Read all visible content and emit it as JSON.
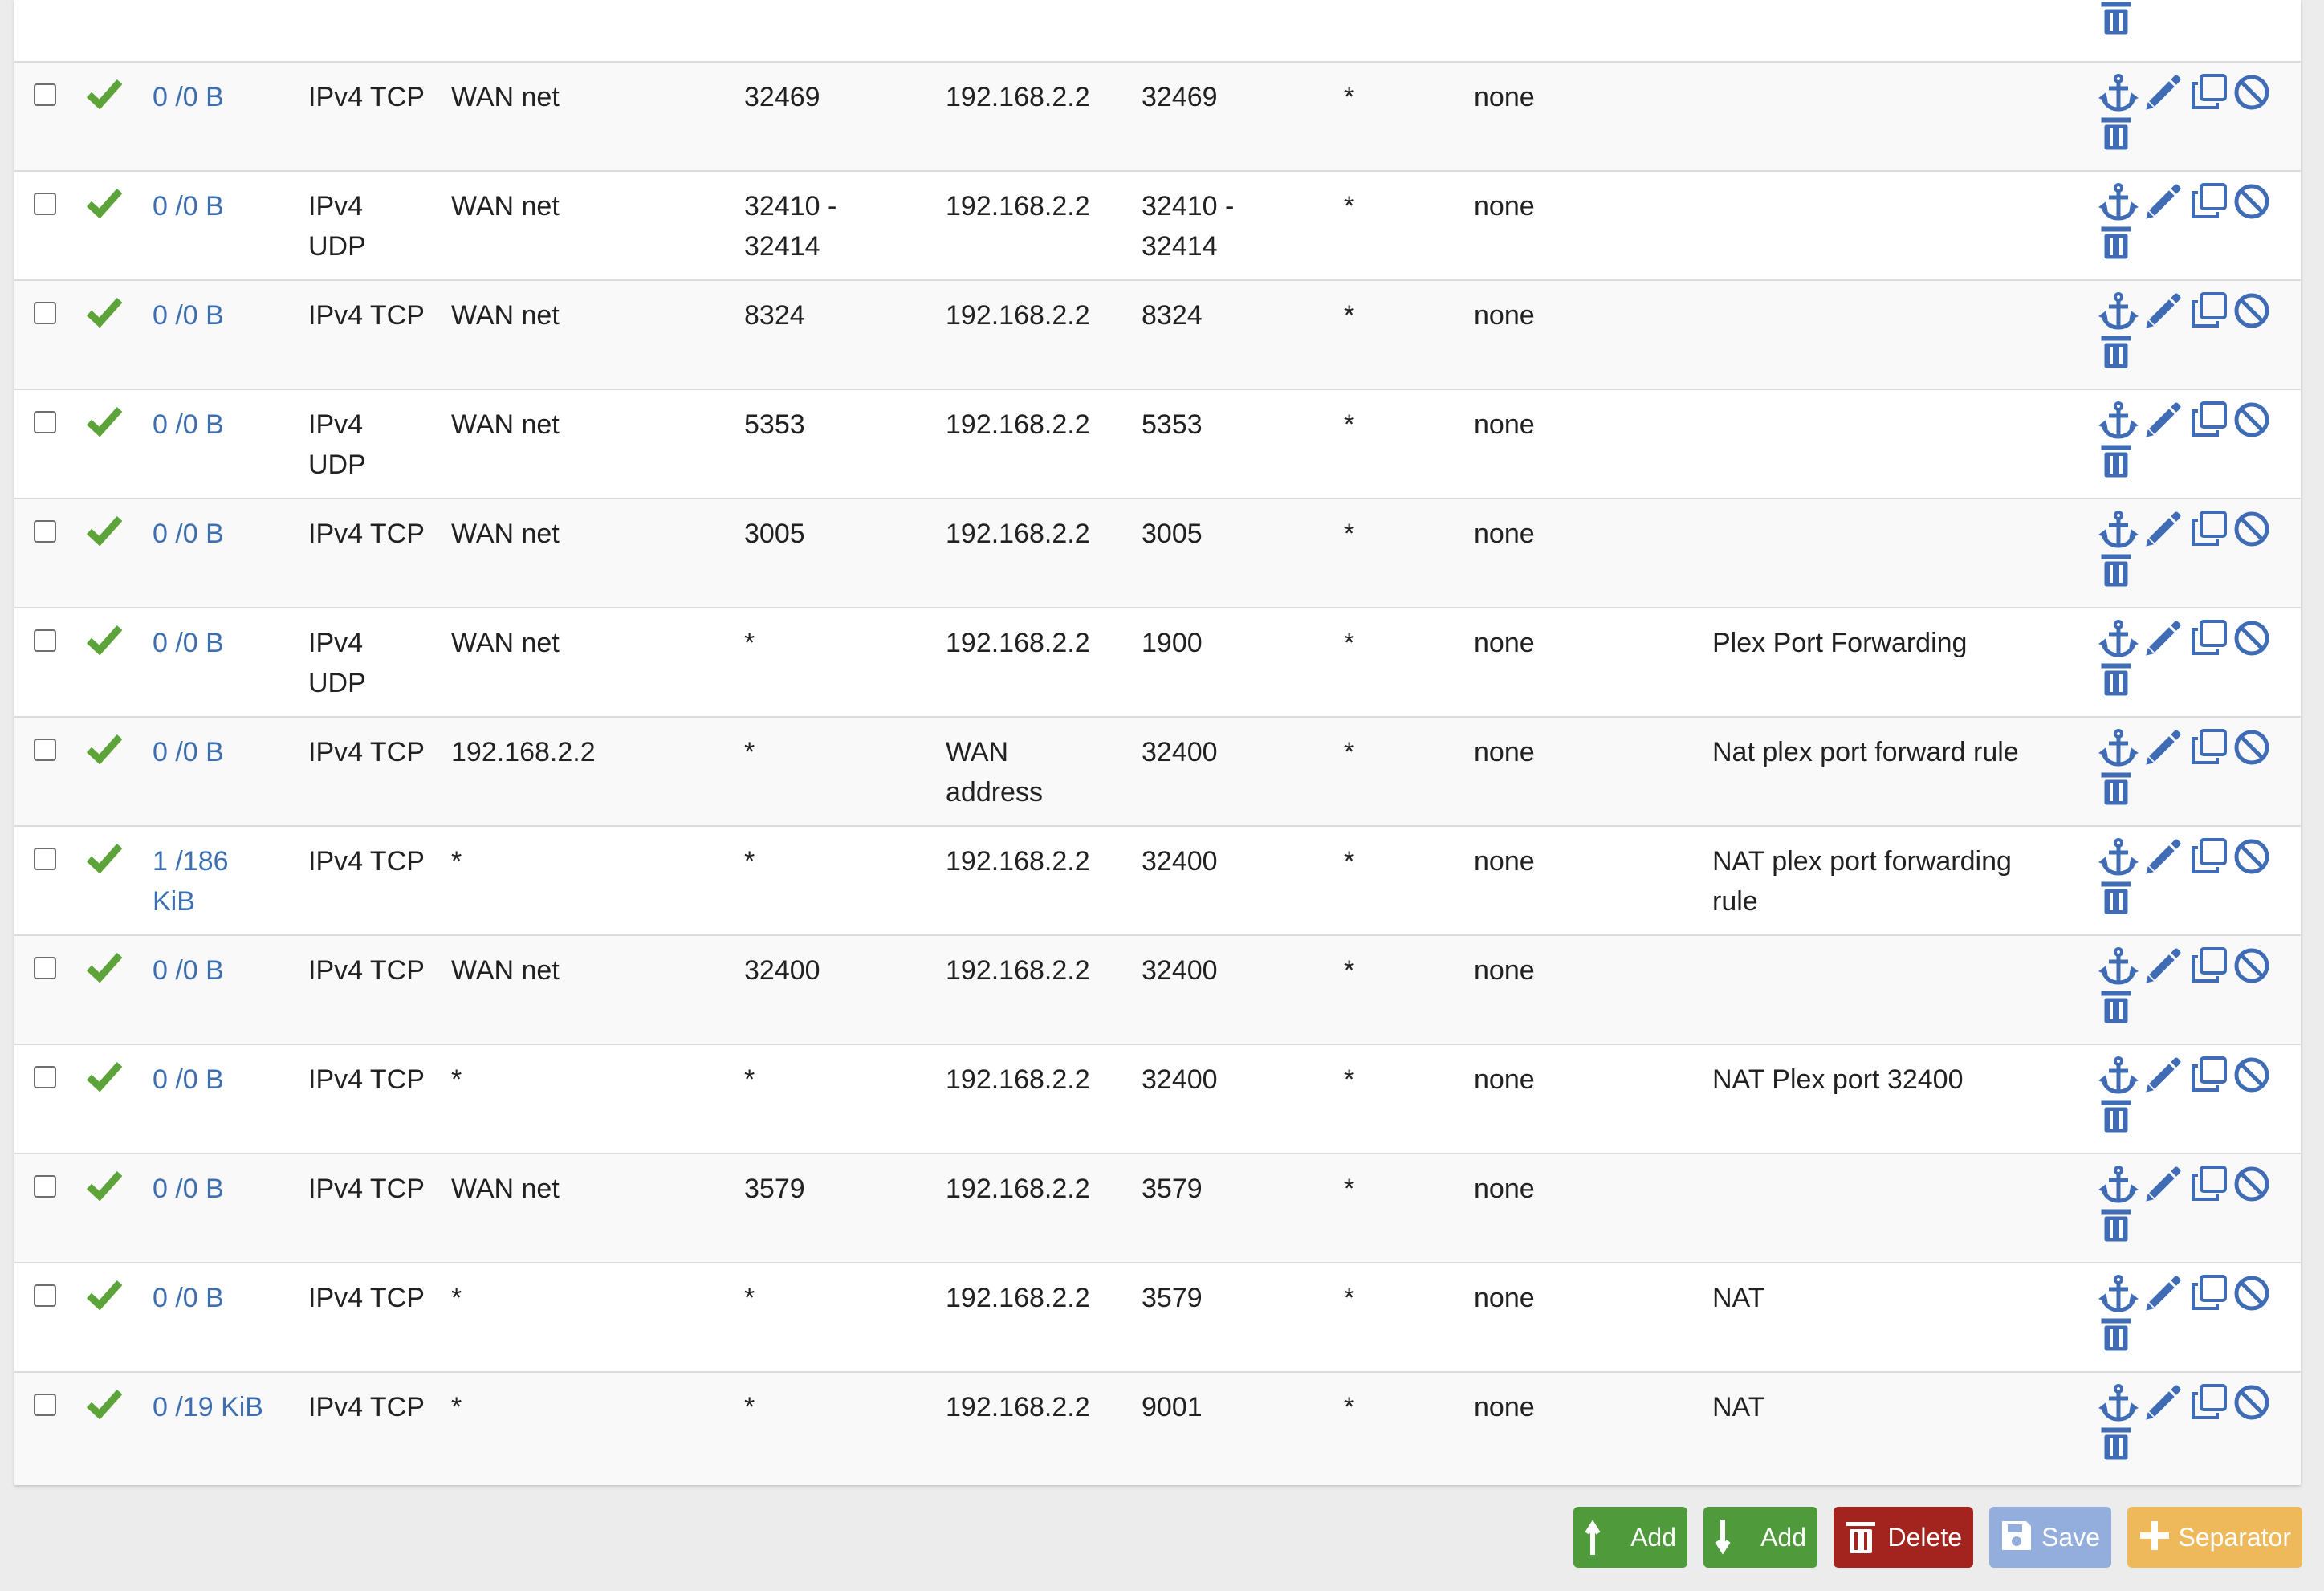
{
  "rows": [
    {
      "states": "",
      "protocol": "",
      "source": "",
      "source_port": "",
      "destination": "",
      "destination_port": "",
      "gateway": "",
      "queue": "",
      "description": ""
    },
    {
      "states": "0 /0 B",
      "protocol": "IPv4 TCP",
      "source": "WAN net",
      "source_port": "32469",
      "destination": "192.168.2.2",
      "destination_port": "32469",
      "gateway": "*",
      "queue": "none",
      "description": ""
    },
    {
      "states": "0 /0 B",
      "protocol": "IPv4 UDP",
      "source": "WAN net",
      "source_port": "32410 - 32414",
      "destination": "192.168.2.2",
      "destination_port": "32410 - 32414",
      "gateway": "*",
      "queue": "none",
      "description": ""
    },
    {
      "states": "0 /0 B",
      "protocol": "IPv4 TCP",
      "source": "WAN net",
      "source_port": "8324",
      "destination": "192.168.2.2",
      "destination_port": "8324",
      "gateway": "*",
      "queue": "none",
      "description": ""
    },
    {
      "states": "0 /0 B",
      "protocol": "IPv4 UDP",
      "source": "WAN net",
      "source_port": "5353",
      "destination": "192.168.2.2",
      "destination_port": "5353",
      "gateway": "*",
      "queue": "none",
      "description": ""
    },
    {
      "states": "0 /0 B",
      "protocol": "IPv4 TCP",
      "source": "WAN net",
      "source_port": "3005",
      "destination": "192.168.2.2",
      "destination_port": "3005",
      "gateway": "*",
      "queue": "none",
      "description": ""
    },
    {
      "states": "0 /0 B",
      "protocol": "IPv4 UDP",
      "source": "WAN net",
      "source_port": "*",
      "destination": "192.168.2.2",
      "destination_port": "1900",
      "gateway": "*",
      "queue": "none",
      "description": "Plex Port Forwarding"
    },
    {
      "states": "0 /0 B",
      "protocol": "IPv4 TCP",
      "source": "192.168.2.2",
      "source_port": "*",
      "destination": "WAN address",
      "destination_port": "32400",
      "gateway": "*",
      "queue": "none",
      "description": "Nat plex port forward rule"
    },
    {
      "states": "1 /186 KiB",
      "protocol": "IPv4 TCP",
      "source": "*",
      "source_port": "*",
      "destination": "192.168.2.2",
      "destination_port": "32400",
      "gateway": "*",
      "queue": "none",
      "description": "NAT plex port forwarding rule"
    },
    {
      "states": "0 /0 B",
      "protocol": "IPv4 TCP",
      "source": "WAN net",
      "source_port": "32400",
      "destination": "192.168.2.2",
      "destination_port": "32400",
      "gateway": "*",
      "queue": "none",
      "description": ""
    },
    {
      "states": "0 /0 B",
      "protocol": "IPv4 TCP",
      "source": "*",
      "source_port": "*",
      "destination": "192.168.2.2",
      "destination_port": "32400",
      "gateway": "*",
      "queue": "none",
      "description": "NAT Plex port 32400"
    },
    {
      "states": "0 /0 B",
      "protocol": "IPv4 TCP",
      "source": "WAN net",
      "source_port": "3579",
      "destination": "192.168.2.2",
      "destination_port": "3579",
      "gateway": "*",
      "queue": "none",
      "description": ""
    },
    {
      "states": "0 /0 B",
      "protocol": "IPv4 TCP",
      "source": "*",
      "source_port": "*",
      "destination": "192.168.2.2",
      "destination_port": "3579",
      "gateway": "*",
      "queue": "none",
      "description": "NAT"
    },
    {
      "states": "0 /19 KiB",
      "protocol": "IPv4 TCP",
      "source": "*",
      "source_port": "*",
      "destination": "192.168.2.2",
      "destination_port": "9001",
      "gateway": "*",
      "queue": "none",
      "description": "NAT"
    }
  ],
  "row_icons": [
    "anchor-icon",
    "pencil-icon",
    "copy-icon",
    "ban-icon",
    "trash-icon"
  ],
  "buttons": {
    "add_top": "Add",
    "add_bottom": "Add",
    "delete": "Delete",
    "save": "Save",
    "separator": "Separator"
  },
  "colors": {
    "link_blue": "#3d6fb0",
    "check_green": "#5ca33a",
    "add_green": "#4f9a3a",
    "delete_red": "#a3231e",
    "save_blue": "#93aedd",
    "separator_orange": "#edb95a"
  }
}
